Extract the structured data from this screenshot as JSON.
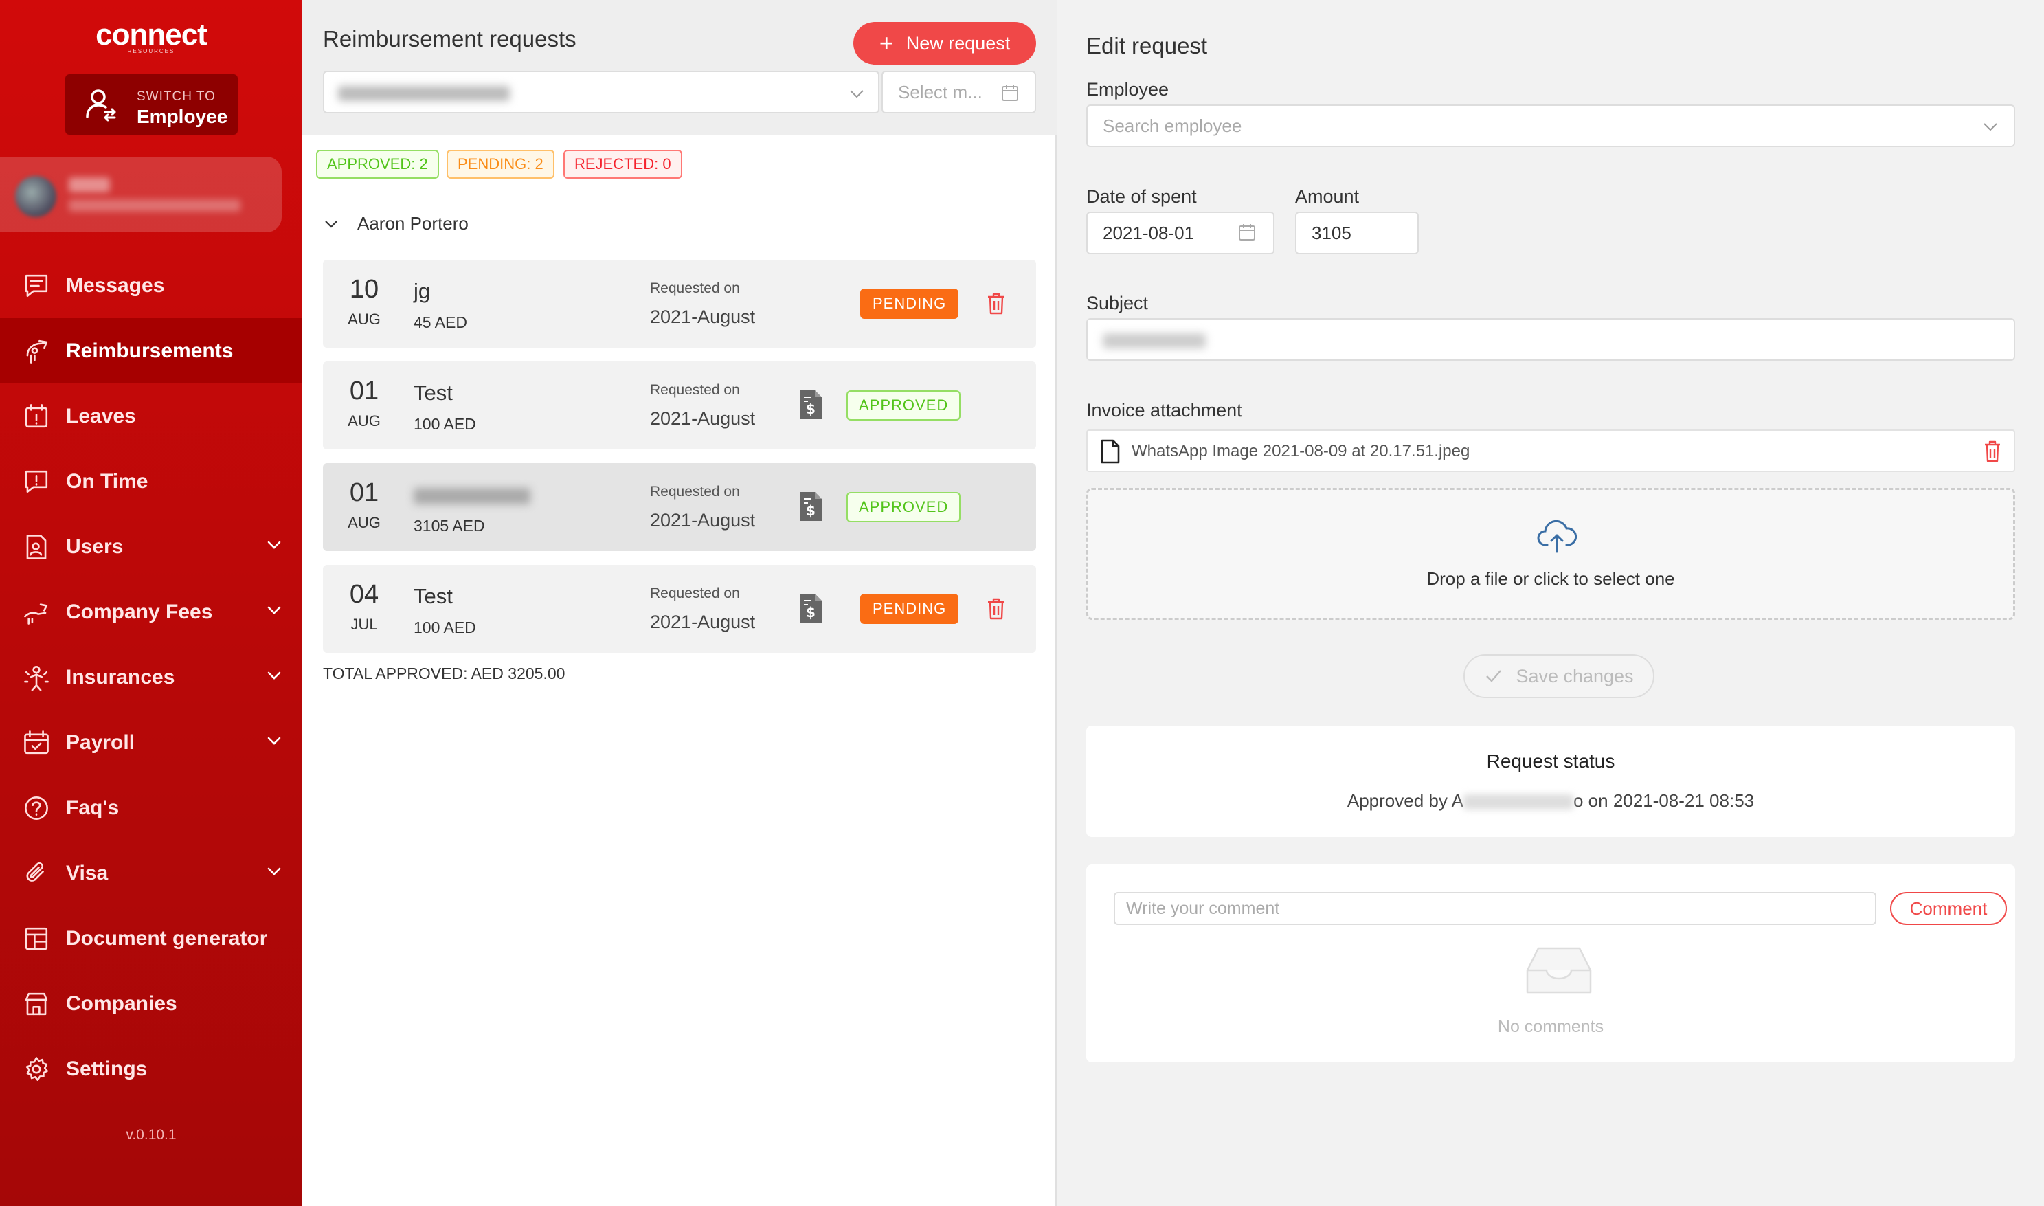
{
  "sidebar": {
    "logo": "connect",
    "logo_sub": "RESOURCES",
    "switch": {
      "small": "SWITCH TO",
      "big": "Employee"
    },
    "nav": [
      {
        "label": "Messages",
        "icon": "message-icon",
        "has_children": false,
        "active": false
      },
      {
        "label": "Reimbursements",
        "icon": "reimbursement-icon",
        "has_children": false,
        "active": true
      },
      {
        "label": "Leaves",
        "icon": "calendar-alert-icon",
        "has_children": false,
        "active": false
      },
      {
        "label": "On Time",
        "icon": "alert-message-icon",
        "has_children": false,
        "active": false
      },
      {
        "label": "Users",
        "icon": "users-doc-icon",
        "has_children": true,
        "active": false
      },
      {
        "label": "Company Fees",
        "icon": "hand-coin-icon",
        "has_children": true,
        "active": false
      },
      {
        "label": "Insurances",
        "icon": "insurance-icon",
        "has_children": true,
        "active": false
      },
      {
        "label": "Payroll",
        "icon": "calendar-check-icon",
        "has_children": true,
        "active": false
      },
      {
        "label": "Faq's",
        "icon": "question-icon",
        "has_children": false,
        "active": false
      },
      {
        "label": "Visa",
        "icon": "paperclip-icon",
        "has_children": true,
        "active": false
      },
      {
        "label": "Document generator",
        "icon": "layout-icon",
        "has_children": false,
        "active": false
      },
      {
        "label": "Companies",
        "icon": "store-icon",
        "has_children": false,
        "active": false
      },
      {
        "label": "Settings",
        "icon": "gear-icon",
        "has_children": false,
        "active": false
      }
    ],
    "version": "v.0.10.1"
  },
  "list": {
    "title": "Reimbursement requests",
    "new_button": "New request",
    "month_placeholder": "Select m...",
    "tags": {
      "approved": "APPROVED: 2",
      "pending": "PENDING: 2",
      "rejected": "REJECTED: 0"
    },
    "group": "Aaron Portero",
    "requested_label": "Requested on",
    "requests": [
      {
        "day": "10",
        "month": "AUG",
        "subject": "jg",
        "amount": "45 AED",
        "requested": "2021-August",
        "status": "PENDING",
        "has_invoice": false
      },
      {
        "day": "01",
        "month": "AUG",
        "subject": "Test",
        "amount": "100 AED",
        "requested": "2021-August",
        "status": "APPROVED",
        "has_invoice": true
      },
      {
        "day": "01",
        "month": "AUG",
        "subject": "",
        "amount": "3105 AED",
        "requested": "2021-August",
        "status": "APPROVED",
        "has_invoice": true
      },
      {
        "day": "04",
        "month": "JUL",
        "subject": "Test",
        "amount": "100 AED",
        "requested": "2021-August",
        "status": "PENDING",
        "has_invoice": true
      }
    ],
    "total": "TOTAL APPROVED: AED 3205.00"
  },
  "edit": {
    "title": "Edit request",
    "employee_label": "Employee",
    "employee_placeholder": "Search employee",
    "date_label": "Date of spent",
    "date_value": "2021-08-01",
    "amount_label": "Amount",
    "amount_value": "3105",
    "subject_label": "Subject",
    "invoice_label": "Invoice attachment",
    "invoice_file": "WhatsApp Image 2021-08-09 at 20.17.51.jpeg",
    "drop_text": "Drop a file or click to select one",
    "save_button": "Save changes",
    "status_title": "Request status",
    "status_prefix": "Approved by A",
    "status_suffix": "o on 2021-08-21 08:53",
    "comment_placeholder": "Write your comment",
    "comment_button": "Comment",
    "no_comments": "No comments"
  },
  "colors": {
    "brand_red": "#d10a0a",
    "accent_button": "#f04848",
    "pending": "#fa6c14",
    "approved": "#52c41a",
    "rejected": "#f5222d"
  }
}
